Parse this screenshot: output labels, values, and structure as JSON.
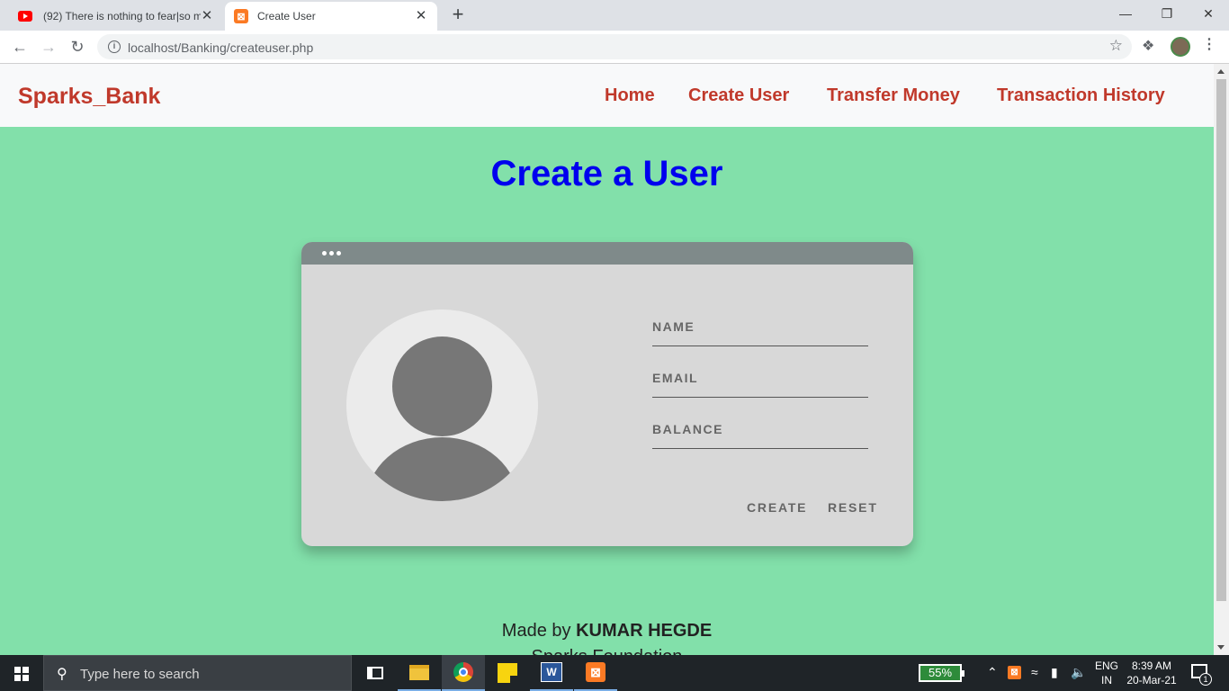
{
  "browser": {
    "tabs": [
      {
        "title": "(92) There is nothing to fear|so m",
        "favicon": "youtube-icon"
      },
      {
        "title": "Create User",
        "favicon": "xampp-icon",
        "active": true
      }
    ],
    "url": "localhost/Banking/createuser.php",
    "new_tab_glyph": "+",
    "close_glyph": "✕"
  },
  "site": {
    "brand": "Sparks_Bank",
    "nav": [
      "Home",
      "Create User",
      "Transfer Money",
      "Transaction History"
    ],
    "accent_color": "#c0392b",
    "background_color": "#82e0aa"
  },
  "main": {
    "heading": "Create a User",
    "form": {
      "name_placeholder": "NAME",
      "email_placeholder": "EMAIL",
      "balance_placeholder": "BALANCE",
      "create_label": "CREATE",
      "reset_label": "RESET"
    }
  },
  "footer": {
    "made_by_prefix": "Made by",
    "author": "KUMAR HEGDE",
    "line2": "Sparks Foundation"
  },
  "taskbar": {
    "search_placeholder": "Type here to search",
    "battery": "55%",
    "lang_top": "ENG",
    "lang_bottom": "IN",
    "time": "8:39 AM",
    "date": "20-Mar-21",
    "notification_count": "1"
  }
}
